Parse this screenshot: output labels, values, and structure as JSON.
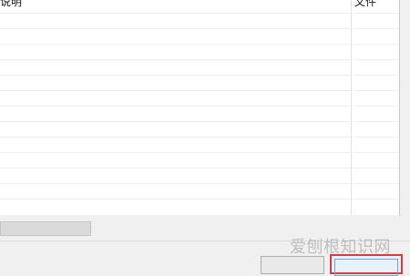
{
  "list": {
    "columns": [
      {
        "label": "说明"
      },
      {
        "label": "文件"
      }
    ],
    "rows": 13
  },
  "watermark": "爱刨根知识网"
}
